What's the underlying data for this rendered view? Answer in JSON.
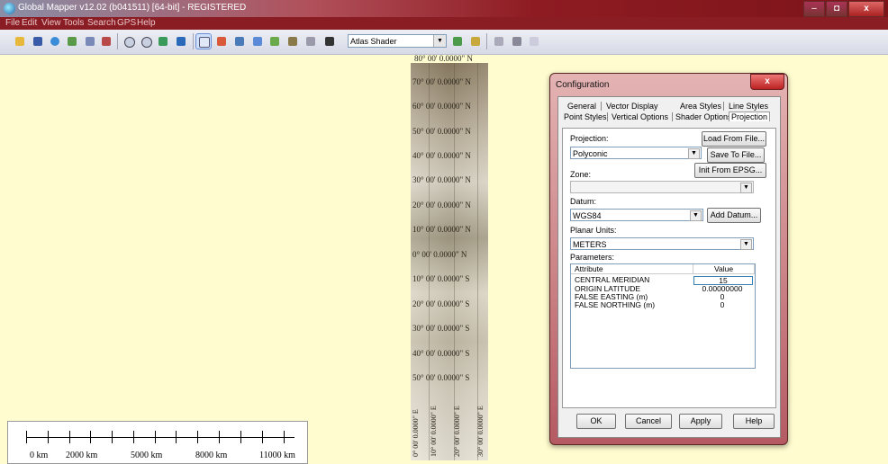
{
  "window": {
    "title": "Global Mapper v12.02 (b041511) [64-bit] - REGISTERED",
    "min": "–",
    "max": "◘",
    "close": "x"
  },
  "menu": [
    "File",
    "Edit",
    "View",
    "Tools",
    "Search",
    "GPS",
    "Help"
  ],
  "toolbar": {
    "shader": "Atlas Shader",
    "icons": [
      "open-folder-icon",
      "save-icon",
      "globe-icon",
      "layer-control-icon",
      "config-icon",
      "wand-icon",
      "zoom-in-icon",
      "zoom-out-icon",
      "zoom-extents-icon",
      "home-icon",
      "select-icon",
      "measure-icon",
      "info-icon",
      "search-map-icon",
      "edit-icon",
      "path-profile-icon",
      "digitizer-icon",
      "find-icon",
      "shader-options-icon",
      "lighting-icon",
      "scale-tool-icon",
      "3d-view-icon",
      "pan-icon"
    ]
  },
  "map": {
    "top_latitude": "80° 00' 0.0000\" N",
    "latitudes": [
      "70° 00' 0.0000\" N",
      "60° 00' 0.0000\" N",
      "50° 00' 0.0000\" N",
      "40° 00' 0.0000\" N",
      "30° 00' 0.0000\" N",
      "20° 00' 0.0000\" N",
      "10° 00' 0.0000\" N",
      "0° 00' 0.0000\" N",
      "10° 00' 0.0000\" S",
      "20° 00' 0.0000\" S",
      "30° 00' 0.0000\" S",
      "40° 00' 0.0000\" S",
      "50° 00' 0.0000\" S"
    ],
    "longitudes": [
      "0° 00' 0.0000\" E",
      "10° 00' 0.0000\" E",
      "20° 00' 0.0000\" E",
      "30° 00' 0.0000\" E"
    ]
  },
  "scalebar": {
    "labels": [
      "0 km",
      "2000 km",
      "5000 km",
      "8000 km",
      "11000 km"
    ]
  },
  "dialog": {
    "title": "Configuration",
    "close": "x",
    "tabs_row1": [
      "General",
      "Vector Display",
      "Area Styles",
      "Line Styles"
    ],
    "tabs_row2": [
      "Point Styles",
      "Vertical Options",
      "Shader Options",
      "Projection"
    ],
    "projection_label": "Projection:",
    "projection_value": "Polyconic",
    "load_from_file": "Load From File...",
    "save_to_file": "Save To File...",
    "init_from_epsg": "Init From EPSG...",
    "zone_label": "Zone:",
    "zone_value": "",
    "datum_label": "Datum:",
    "datum_value": "WGS84",
    "add_datum": "Add Datum...",
    "planar_units_label": "Planar Units:",
    "planar_units_value": "METERS",
    "parameters_label": "Parameters:",
    "param_headers": [
      "Attribute",
      "Value"
    ],
    "params": [
      {
        "attribute": "CENTRAL MERIDIAN",
        "value": "15"
      },
      {
        "attribute": "ORIGIN LATITUDE",
        "value": "0.00000000"
      },
      {
        "attribute": "FALSE EASTING (m)",
        "value": "0"
      },
      {
        "attribute": "FALSE NORTHING (m)",
        "value": "0"
      }
    ],
    "ok": "OK",
    "cancel": "Cancel",
    "apply": "Apply",
    "help": "Help"
  }
}
